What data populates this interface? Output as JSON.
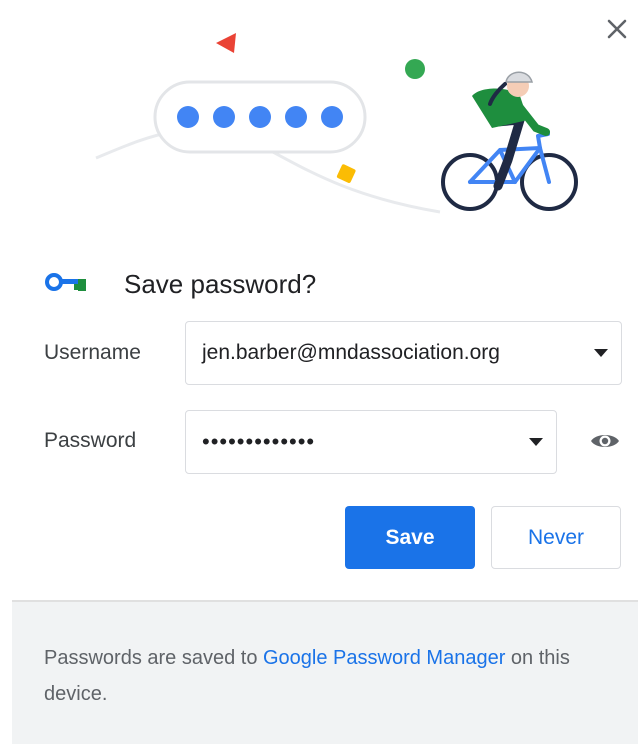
{
  "dialog": {
    "title": "Save password?",
    "close_icon": "close-icon"
  },
  "form": {
    "username_label": "Username",
    "username_value": "jen.barber@mndassociation.org",
    "password_label": "Password",
    "password_value": "•••••••••••••"
  },
  "actions": {
    "save_label": "Save",
    "never_label": "Never"
  },
  "footer": {
    "text_before": "Passwords are saved to ",
    "link": "Google Password Manager",
    "text_after": " on this device."
  },
  "colors": {
    "primary": "#1a73e8",
    "footer_bg": "#f1f3f4",
    "key_blue": "#1a73e8",
    "key_green": "#1e8e3e"
  },
  "icons": [
    "close-icon",
    "key-icon",
    "chevron-down-icon",
    "eye-icon",
    "cyclist-illustration"
  ]
}
